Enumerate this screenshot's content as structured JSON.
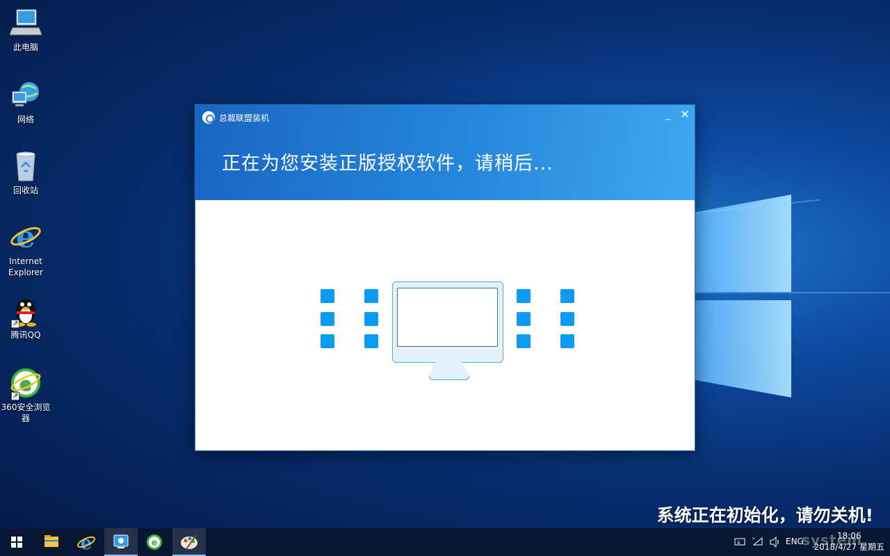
{
  "desktop": {
    "icons": [
      {
        "label": "此电脑",
        "icon": "computer-icon"
      },
      {
        "label": "网络",
        "icon": "network-icon"
      },
      {
        "label": "回收站",
        "icon": "recycle-bin-icon"
      },
      {
        "label": "Internet Explorer",
        "icon": "ie-icon"
      },
      {
        "label": "腾讯QQ",
        "icon": "qq-penguin-icon"
      },
      {
        "label": "360安全浏览器",
        "icon": "360-browser-icon"
      }
    ]
  },
  "dialog": {
    "title": "总裁联盟装机",
    "message": "正在为您安装正版授权软件，请稍后...",
    "minimize_label": "_",
    "close_label": "✕"
  },
  "notice": "系统正在初始化，请勿关机!",
  "taskbar": {
    "apps": [
      "start-icon",
      "file-explorer-icon",
      "ie-icon",
      "installer-icon",
      "360-browser-icon",
      "paint-icon"
    ],
    "tray": {
      "language": "ENG",
      "time": "18:06",
      "date": "2018/4/27 星期五"
    }
  },
  "watermark": "system"
}
